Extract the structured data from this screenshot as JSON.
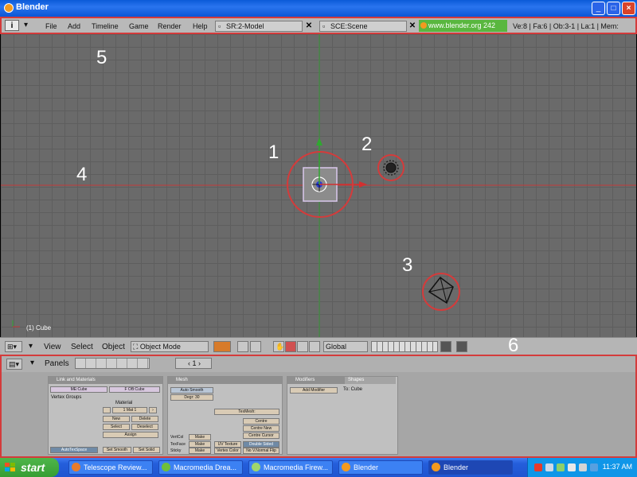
{
  "window": {
    "title": "Blender"
  },
  "header": {
    "menu": [
      "File",
      "Add",
      "Timeline",
      "Game",
      "Render",
      "Help"
    ],
    "screen_field": "SR:2-Model",
    "scene_field": "SCE:Scene",
    "url": "www.blender.org 242",
    "stats": "Ve:8 | Fa:6 | Ob:3-1 | La:1 | Mem:"
  },
  "viewport": {
    "object_label": "(1) Cube",
    "annotations": [
      "1",
      "2",
      "3",
      "4",
      "5",
      "6"
    ]
  },
  "view_header": {
    "menu": [
      "View",
      "Select",
      "Object"
    ],
    "mode": "Object Mode",
    "orientation": "Global"
  },
  "buttons_window": {
    "panels_label": "Panels",
    "frame": "1",
    "link_panel": {
      "title": "Link and Materials",
      "me_field": "ME:Cube",
      "ob_field": "F OB:Cube",
      "vertex_groups": "Vertex Groups",
      "material": "Material",
      "mat_field": "1 Mat 1",
      "buttons": [
        "New",
        "Delete",
        "Select",
        "Deselect",
        "Assign"
      ],
      "autotex": "AutoTexSpace",
      "set_smooth": "Set Smooth",
      "set_solid": "Set Solid"
    },
    "mesh_panel": {
      "title": "Mesh",
      "auto_smooth": "Auto Smooth",
      "degr": "Degr: 30",
      "tex_mesh": "TexMesh:",
      "sticky": "Sticky",
      "uv_tex": "UV Texture",
      "vcol": "Vertex Color",
      "vertcol": "VertCol",
      "texface": "TexFace",
      "sticky2": "Sticky",
      "make": "Make",
      "centre": "Centre",
      "centre_new": "Centre New",
      "centre_cursor": "Centre Cursor",
      "double_sided": "Double Sided",
      "no_vnormal": "No V.Normal Flip"
    },
    "modifiers_panel": {
      "tab_modifiers": "Modifiers",
      "tab_shapes": "Shapes",
      "add_modifier": "Add Modifier",
      "to": "To: Cube"
    }
  },
  "taskbar": {
    "start": "start",
    "tasks": [
      "Telescope Review...",
      "Macromedia Drea...",
      "Macromedia Firew...",
      "Blender",
      "Blender"
    ],
    "clock": "11:37 AM"
  },
  "colors": {
    "accent_red": "#d43b3b",
    "grid_bg": "#6a6a6a",
    "xp_blue": "#245edb",
    "url_green": "#59b73f"
  }
}
